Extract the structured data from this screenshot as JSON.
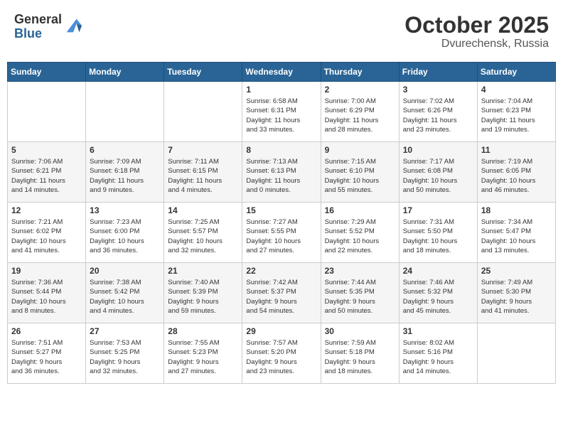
{
  "header": {
    "logo_general": "General",
    "logo_blue": "Blue",
    "month": "October 2025",
    "location": "Dvurechensk, Russia"
  },
  "weekdays": [
    "Sunday",
    "Monday",
    "Tuesday",
    "Wednesday",
    "Thursday",
    "Friday",
    "Saturday"
  ],
  "rows": [
    {
      "shade": "white",
      "cells": [
        {
          "day": "",
          "info": ""
        },
        {
          "day": "",
          "info": ""
        },
        {
          "day": "",
          "info": ""
        },
        {
          "day": "1",
          "info": "Sunrise: 6:58 AM\nSunset: 6:31 PM\nDaylight: 11 hours\nand 33 minutes."
        },
        {
          "day": "2",
          "info": "Sunrise: 7:00 AM\nSunset: 6:29 PM\nDaylight: 11 hours\nand 28 minutes."
        },
        {
          "day": "3",
          "info": "Sunrise: 7:02 AM\nSunset: 6:26 PM\nDaylight: 11 hours\nand 23 minutes."
        },
        {
          "day": "4",
          "info": "Sunrise: 7:04 AM\nSunset: 6:23 PM\nDaylight: 11 hours\nand 19 minutes."
        }
      ]
    },
    {
      "shade": "shade",
      "cells": [
        {
          "day": "5",
          "info": "Sunrise: 7:06 AM\nSunset: 6:21 PM\nDaylight: 11 hours\nand 14 minutes."
        },
        {
          "day": "6",
          "info": "Sunrise: 7:09 AM\nSunset: 6:18 PM\nDaylight: 11 hours\nand 9 minutes."
        },
        {
          "day": "7",
          "info": "Sunrise: 7:11 AM\nSunset: 6:15 PM\nDaylight: 11 hours\nand 4 minutes."
        },
        {
          "day": "8",
          "info": "Sunrise: 7:13 AM\nSunset: 6:13 PM\nDaylight: 11 hours\nand 0 minutes."
        },
        {
          "day": "9",
          "info": "Sunrise: 7:15 AM\nSunset: 6:10 PM\nDaylight: 10 hours\nand 55 minutes."
        },
        {
          "day": "10",
          "info": "Sunrise: 7:17 AM\nSunset: 6:08 PM\nDaylight: 10 hours\nand 50 minutes."
        },
        {
          "day": "11",
          "info": "Sunrise: 7:19 AM\nSunset: 6:05 PM\nDaylight: 10 hours\nand 46 minutes."
        }
      ]
    },
    {
      "shade": "white",
      "cells": [
        {
          "day": "12",
          "info": "Sunrise: 7:21 AM\nSunset: 6:02 PM\nDaylight: 10 hours\nand 41 minutes."
        },
        {
          "day": "13",
          "info": "Sunrise: 7:23 AM\nSunset: 6:00 PM\nDaylight: 10 hours\nand 36 minutes."
        },
        {
          "day": "14",
          "info": "Sunrise: 7:25 AM\nSunset: 5:57 PM\nDaylight: 10 hours\nand 32 minutes."
        },
        {
          "day": "15",
          "info": "Sunrise: 7:27 AM\nSunset: 5:55 PM\nDaylight: 10 hours\nand 27 minutes."
        },
        {
          "day": "16",
          "info": "Sunrise: 7:29 AM\nSunset: 5:52 PM\nDaylight: 10 hours\nand 22 minutes."
        },
        {
          "day": "17",
          "info": "Sunrise: 7:31 AM\nSunset: 5:50 PM\nDaylight: 10 hours\nand 18 minutes."
        },
        {
          "day": "18",
          "info": "Sunrise: 7:34 AM\nSunset: 5:47 PM\nDaylight: 10 hours\nand 13 minutes."
        }
      ]
    },
    {
      "shade": "shade",
      "cells": [
        {
          "day": "19",
          "info": "Sunrise: 7:36 AM\nSunset: 5:44 PM\nDaylight: 10 hours\nand 8 minutes."
        },
        {
          "day": "20",
          "info": "Sunrise: 7:38 AM\nSunset: 5:42 PM\nDaylight: 10 hours\nand 4 minutes."
        },
        {
          "day": "21",
          "info": "Sunrise: 7:40 AM\nSunset: 5:39 PM\nDaylight: 9 hours\nand 59 minutes."
        },
        {
          "day": "22",
          "info": "Sunrise: 7:42 AM\nSunset: 5:37 PM\nDaylight: 9 hours\nand 54 minutes."
        },
        {
          "day": "23",
          "info": "Sunrise: 7:44 AM\nSunset: 5:35 PM\nDaylight: 9 hours\nand 50 minutes."
        },
        {
          "day": "24",
          "info": "Sunrise: 7:46 AM\nSunset: 5:32 PM\nDaylight: 9 hours\nand 45 minutes."
        },
        {
          "day": "25",
          "info": "Sunrise: 7:49 AM\nSunset: 5:30 PM\nDaylight: 9 hours\nand 41 minutes."
        }
      ]
    },
    {
      "shade": "white",
      "cells": [
        {
          "day": "26",
          "info": "Sunrise: 7:51 AM\nSunset: 5:27 PM\nDaylight: 9 hours\nand 36 minutes."
        },
        {
          "day": "27",
          "info": "Sunrise: 7:53 AM\nSunset: 5:25 PM\nDaylight: 9 hours\nand 32 minutes."
        },
        {
          "day": "28",
          "info": "Sunrise: 7:55 AM\nSunset: 5:23 PM\nDaylight: 9 hours\nand 27 minutes."
        },
        {
          "day": "29",
          "info": "Sunrise: 7:57 AM\nSunset: 5:20 PM\nDaylight: 9 hours\nand 23 minutes."
        },
        {
          "day": "30",
          "info": "Sunrise: 7:59 AM\nSunset: 5:18 PM\nDaylight: 9 hours\nand 18 minutes."
        },
        {
          "day": "31",
          "info": "Sunrise: 8:02 AM\nSunset: 5:16 PM\nDaylight: 9 hours\nand 14 minutes."
        },
        {
          "day": "",
          "info": ""
        }
      ]
    }
  ]
}
